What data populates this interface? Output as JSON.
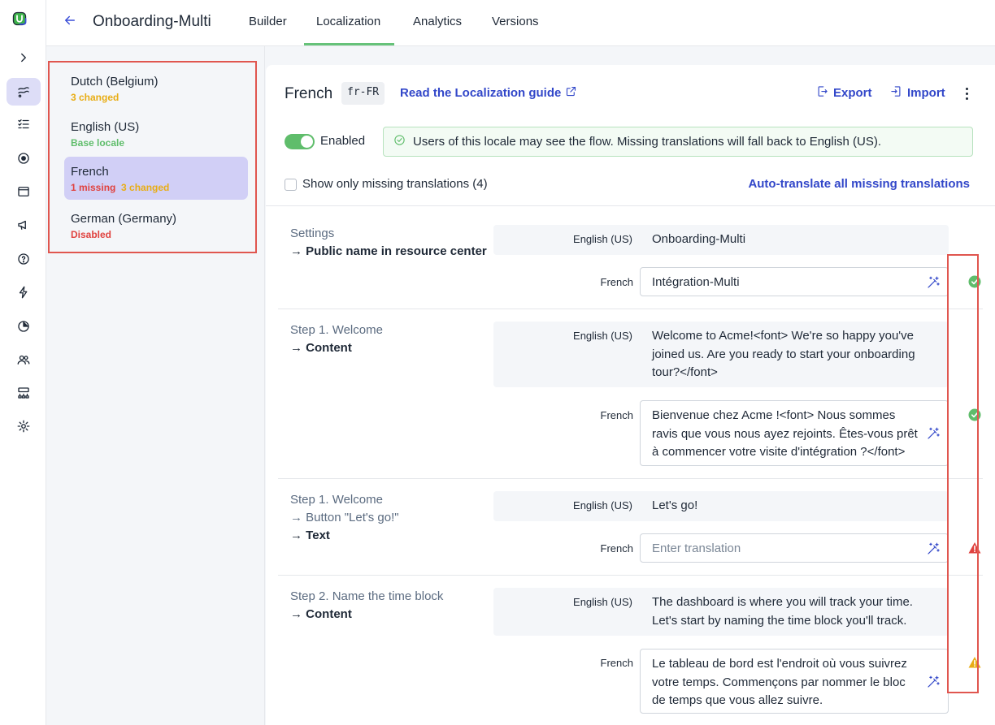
{
  "app": {
    "flow_title": "Onboarding-Multi",
    "tabs": [
      {
        "label": "Builder"
      },
      {
        "label": "Localization"
      },
      {
        "label": "Analytics"
      },
      {
        "label": "Versions"
      }
    ],
    "active_tab": "Localization",
    "accent": "#3247c9",
    "success": "#5fbd6b",
    "warning": "#e8ad15",
    "danger": "#e0423f"
  },
  "rail": {
    "icons": [
      "logo-icon",
      "expand-icon",
      "flows-icon",
      "checklist-icon",
      "target-icon",
      "window-icon",
      "megaphone-icon",
      "help-icon",
      "bolt-icon",
      "pie-chart-icon",
      "users-icon",
      "org-chart-icon",
      "settings-icon"
    ]
  },
  "locales": [
    {
      "name": "Dutch (Belgium)",
      "status": [
        {
          "text": "3 changed",
          "kind": "changed"
        }
      ]
    },
    {
      "name": "English (US)",
      "status": [
        {
          "text": "Base locale",
          "kind": "base"
        }
      ]
    },
    {
      "name": "French",
      "status": [
        {
          "text": "1 missing",
          "kind": "missing"
        },
        {
          "text": "3 changed",
          "kind": "changed"
        }
      ],
      "selected": true
    },
    {
      "name": "German (Germany)",
      "status": [
        {
          "text": "Disabled",
          "kind": "missing"
        }
      ]
    }
  ],
  "locale_detail": {
    "title": "French",
    "code": "fr-FR",
    "guide_link": "Read the Localization guide",
    "export_label": "Export",
    "import_label": "Import",
    "enabled_label": "Enabled",
    "enabled": true,
    "notice": "Users of this locale may see the flow. Missing translations will fall back to English (US).",
    "missing_filter_label": "Show only missing translations (4)",
    "auto_translate_label": "Auto-translate all missing translations"
  },
  "rows": [
    {
      "crumbs": [
        "Settings"
      ],
      "field": "Public name in resource center",
      "source_label": "English (US)",
      "source_text": "Onboarding-Multi",
      "target_label": "French",
      "target_text": "Intégration-Multi",
      "target_placeholder": "",
      "status": "ok"
    },
    {
      "crumbs": [
        "Step 1. Welcome"
      ],
      "field": "Content",
      "source_label": "English (US)",
      "source_text": "Welcome to Acme!<font> We're so happy you've joined us. Are you ready to start your onboarding tour?</font>",
      "target_label": "French",
      "target_text": "Bienvenue chez Acme !<font> Nous sommes ravis que vous nous ayez rejoints. Êtes-vous prêt à commencer votre visite d'intégration ?</font>",
      "target_placeholder": "",
      "status": "ok"
    },
    {
      "crumbs": [
        "Step 1. Welcome",
        "Button \"Let's go!\""
      ],
      "field": "Text",
      "source_label": "English (US)",
      "source_text": "Let's go!",
      "target_label": "French",
      "target_text": "",
      "target_placeholder": "Enter translation",
      "status": "missing"
    },
    {
      "crumbs": [
        "Step 2. Name the time block"
      ],
      "field": "Content",
      "source_label": "English (US)",
      "source_text": "The dashboard is where you will track your time. Let's start by naming the time block you'll track.",
      "target_label": "French",
      "target_text": "Le tableau de bord est l'endroit où vous suivrez votre temps. Commençons par nommer le bloc de temps que vous allez suivre.",
      "target_placeholder": "",
      "status": "changed"
    }
  ]
}
